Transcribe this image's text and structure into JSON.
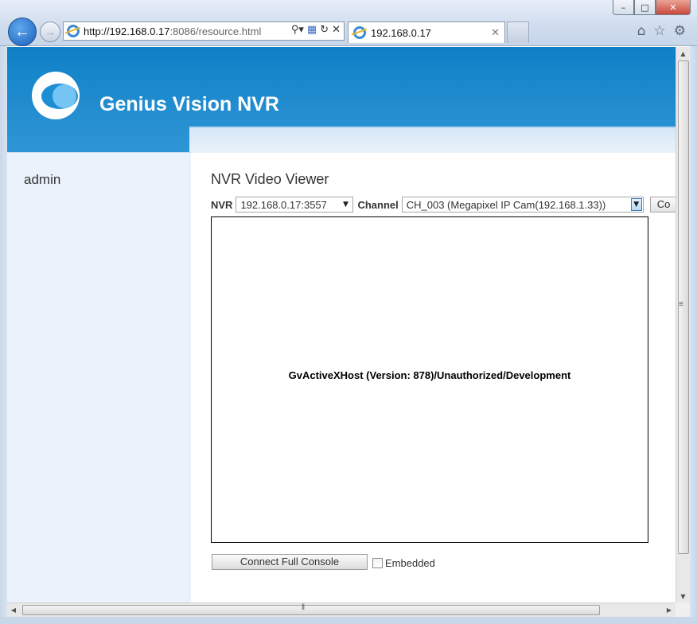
{
  "browser": {
    "address": {
      "host": "http://192.168.0.17",
      "rest": ":8086/resource.html"
    },
    "tab_title": "192.168.0.17",
    "window_buttons": {
      "minimize": "–",
      "maximize": "□",
      "close": "✕"
    },
    "icons": [
      "back-arrow-icon",
      "forward-arrow-icon",
      "ie-logo-icon",
      "search-icon",
      "compatibility-icon",
      "refresh-icon",
      "stop-icon",
      "home-icon",
      "favorites-star-icon",
      "settings-gear-icon"
    ]
  },
  "app": {
    "brand": "Genius Vision NVR",
    "user": "admin"
  },
  "viewer": {
    "title": "NVR Video Viewer",
    "nvr_label": "NVR",
    "nvr_value": "192.168.0.17:3557",
    "channel_label": "Channel",
    "channel_value": "CH_003 (Megapixel IP Cam(192.168.1.33))",
    "connect_partial": "Co",
    "video_message": "GvActiveXHost (Version: 878)/Unauthorized/Development",
    "connect_full_console": "Connect Full Console",
    "embedded_label": "Embedded",
    "embedded_checked": false
  }
}
